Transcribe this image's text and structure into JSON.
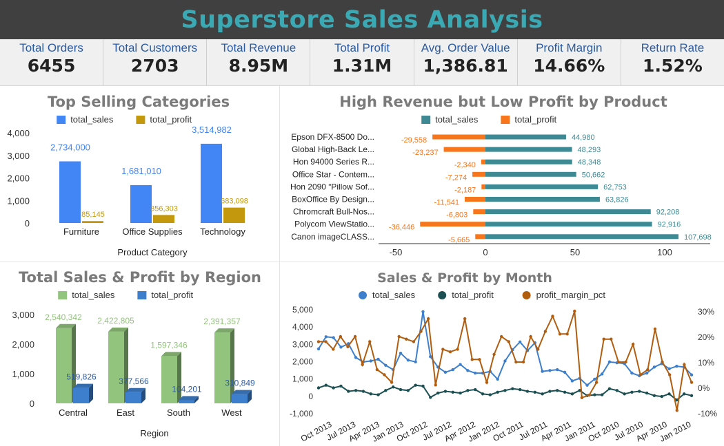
{
  "title": "Superstore Sales Analysis",
  "kpis": [
    {
      "label": "Total Orders",
      "value": "6455"
    },
    {
      "label": "Total Customers",
      "value": "2703"
    },
    {
      "label": "Total Revenue",
      "value": "8.95M"
    },
    {
      "label": "Total Profit",
      "value": "1.31M"
    },
    {
      "label": "Avg. Order Value",
      "value": "1,386.81"
    },
    {
      "label": "Profit Margin",
      "value": "14.66%"
    },
    {
      "label": "Return Rate",
      "value": "1.52%"
    }
  ],
  "colors": {
    "accent_title": "#3aa9b4",
    "blue": "#4285f4",
    "gold": "#c4980c",
    "teal": "#3d8a94",
    "orange": "#f7751b",
    "green": "#93c47d",
    "region_blue": "#3d7fcc",
    "dark_teal": "#1b4f52",
    "brown": "#b15d0f"
  },
  "chart_data": [
    {
      "type": "bar",
      "title": "Top Selling Categories",
      "xlabel": "Product Category",
      "ylabel": "",
      "categories": [
        "Furniture",
        "Office Supplies",
        "Technology"
      ],
      "series": [
        {
          "name": "total_sales",
          "values": [
            2734000,
            1681010,
            3514982
          ],
          "labels": [
            "2,734,000",
            "1,681,010",
            "3,514,982"
          ]
        },
        {
          "name": "total_profit",
          "values": [
            85145,
            356303,
            683098
          ],
          "labels": [
            "85,145",
            "356,303",
            "683,098"
          ]
        }
      ],
      "ylim": [
        0,
        4000000
      ],
      "y_ticks": [
        "0",
        "1,000",
        "2,000",
        "3,000",
        "4,000"
      ],
      "legend": "top-center",
      "grid": false
    },
    {
      "type": "bar",
      "orientation": "horizontal",
      "title": "High Revenue but Low Profit by Product",
      "categories": [
        "Epson DFX-8500 Do...",
        "Global High-Back Le...",
        "Hon 94000 Series R...",
        "Office Star - Contem...",
        "Hon 2090 “Pillow Sof...",
        "BoxOffice By Design...",
        "Chromcraft Bull-Nos...",
        "Polycom ViewStatio...",
        "Canon imageCLASS..."
      ],
      "series": [
        {
          "name": "total_sales",
          "values": [
            44980,
            48293,
            48348,
            50662,
            62753,
            63826,
            92208,
            92916,
            107698
          ],
          "labels": [
            "44,980",
            "48,293",
            "48,348",
            "50,662",
            "62,753",
            "63,826",
            "92,208",
            "92,916",
            "107,698"
          ]
        },
        {
          "name": "total_profit",
          "values": [
            -29558,
            -23237,
            -2340,
            -7274,
            -2187,
            -11541,
            -6803,
            -36446,
            -5665
          ],
          "labels": [
            "-29,558",
            "-23,237",
            "-2,340",
            "-7,274",
            "-2,187",
            "-11,541",
            "-6,803",
            "-36,446",
            "-5,665"
          ]
        }
      ],
      "xlim": [
        -50000,
        115000
      ],
      "x_ticks": [
        "-50",
        "0",
        "50",
        "100"
      ],
      "legend": "top-center",
      "grid": false
    },
    {
      "type": "bar",
      "title": "Total Sales & Profit by Region",
      "xlabel": "Region",
      "categories": [
        "Central",
        "East",
        "South",
        "West"
      ],
      "series": [
        {
          "name": "total_sales",
          "values": [
            2540342,
            2422805,
            1597346,
            2391357
          ],
          "labels": [
            "2,540,342",
            "2,422,805",
            "1,597,346",
            "2,391,357"
          ]
        },
        {
          "name": "total_profit",
          "values": [
            519826,
            377566,
            104201,
            310849
          ],
          "labels": [
            "519,826",
            "377,566",
            "104,201",
            "310,849"
          ]
        }
      ],
      "ylim": [
        0,
        3000000
      ],
      "y_ticks": [
        "0",
        "1,000",
        "2,000",
        "3,000"
      ],
      "legend": "top-center",
      "grid": false
    },
    {
      "type": "line",
      "title": "Sales & Profit by Month",
      "x_ticks": [
        "Oct 2013",
        "Jul 2013",
        "Apr 2013",
        "Jan 2013",
        "Oct 2012",
        "Jul 2012",
        "Apr 2012",
        "Jan 2012",
        "Oct 2011",
        "Jul 2011",
        "Apr 2011",
        "Jan 2011",
        "Oct 2010",
        "Jul 2010",
        "Apr 2010",
        "Jan 2010"
      ],
      "y_ticks": [
        "-1,000",
        "0",
        "1,000",
        "2,000",
        "3,000",
        "4,000",
        "5,000"
      ],
      "y2_ticks": [
        "-10%",
        "0%",
        "10%",
        "20%",
        "30%"
      ],
      "ylim": [
        -1000,
        5000
      ],
      "y2lim": [
        -10,
        30
      ],
      "series": [
        {
          "name": "total_sales",
          "axis": "left",
          "values": [
            2700,
            3400,
            3350,
            2800,
            3000,
            2200,
            1950,
            2000,
            2100,
            1750,
            1500,
            2450,
            2050,
            1950,
            4850,
            2250,
            1650,
            1350,
            1500,
            1800,
            1450,
            1300,
            1300,
            1400,
            950,
            2000,
            2650,
            3100,
            2600,
            3050,
            1400,
            1450,
            1500,
            1350,
            850,
            1000,
            600,
            950,
            1250,
            1950,
            1900,
            1850,
            1300,
            1150,
            1300,
            1650,
            1850,
            1550,
            1700,
            1650,
            1200
          ]
        },
        {
          "name": "total_profit",
          "axis": "left",
          "values": [
            450,
            600,
            450,
            550,
            250,
            300,
            250,
            100,
            50,
            300,
            500,
            350,
            300,
            600,
            550,
            -100,
            150,
            250,
            200,
            150,
            300,
            350,
            100,
            50,
            200,
            300,
            400,
            350,
            250,
            200,
            100,
            250,
            300,
            200,
            100,
            300,
            0,
            50,
            50,
            400,
            300,
            100,
            200,
            250,
            150,
            0,
            -50,
            100,
            -250,
            100,
            0
          ]
        },
        {
          "name": "profit_margin_pct",
          "axis": "right",
          "values": [
            18,
            18,
            15,
            20,
            16,
            20,
            9,
            18,
            7,
            5,
            2,
            20,
            19,
            18,
            22,
            27,
            1,
            15,
            14,
            15,
            27,
            11,
            11,
            2,
            13,
            20,
            18,
            10,
            10,
            20,
            15,
            22,
            28,
            21,
            21,
            30,
            -4,
            -3,
            2,
            19,
            19,
            10,
            10,
            17,
            5,
            7,
            23,
            10,
            5,
            -9,
            9,
            2
          ]
        }
      ],
      "legend": "top-center",
      "grid": false
    }
  ]
}
